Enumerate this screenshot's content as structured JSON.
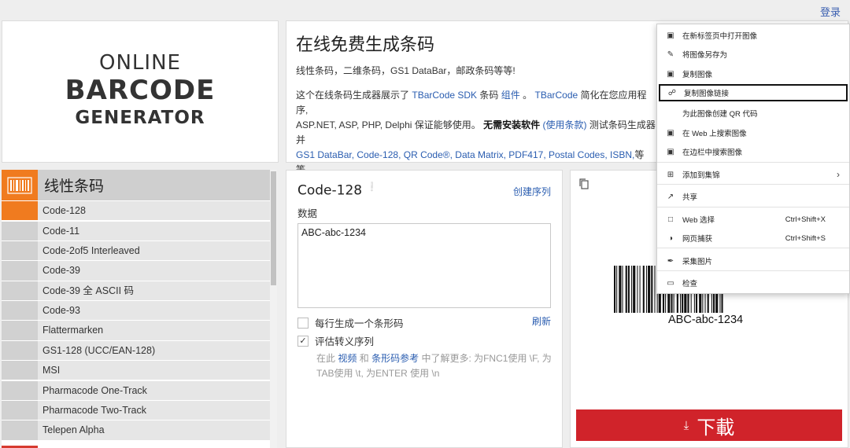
{
  "header": {
    "login": "登录"
  },
  "logo": {
    "line1": "ONLINE",
    "line2": "BARCODE",
    "line3": "GENERATOR"
  },
  "intro": {
    "title": "在线免费生成条码",
    "subtitle": "线性条码，二维条码，GS1 DataBar，邮政条码等等!",
    "desc_1": "这个在线条码生成器展示了",
    "desc_link_sdk": "TBarCode SDK",
    "desc_2": "条码",
    "desc_link_component": "组件",
    "desc_3": "。",
    "desc_link_tbarcode": "TBarCode",
    "desc_4": "简化在您应用程序,",
    "desc_5": "ASP.NET, ASP, PHP, Delphi 保证能够使用。",
    "desc_bold": "无需安装软件",
    "desc_link_terms": "(使用条款)",
    "desc_6": "测试条码生成器并",
    "desc_links_types": "GS1 DataBar, Code-128, QR Code®, Data Matrix, PDF417, Postal Codes, ISBN,",
    "desc_7": "等等。"
  },
  "sidebar": {
    "header": "线性条码",
    "items": [
      {
        "label": "Code-128",
        "active": true
      },
      {
        "label": "Code-11"
      },
      {
        "label": "Code-2of5 Interleaved"
      },
      {
        "label": "Code-39"
      },
      {
        "label": "Code-39 全 ASCII 码"
      },
      {
        "label": "Code-93"
      },
      {
        "label": "Flattermarken"
      },
      {
        "label": "GS1-128 (UCC/EAN-128)"
      },
      {
        "label": "MSI"
      },
      {
        "label": "Pharmacode One-Track"
      },
      {
        "label": "Pharmacode Two-Track"
      },
      {
        "label": "Telepen Alpha"
      }
    ]
  },
  "data_panel": {
    "title": "Code-128",
    "info_icon": "info-icon",
    "create_series": "创建序列",
    "data_label": "数据",
    "data_value": "ABC-abc-1234",
    "one_per_line": "每行生成一个条形码",
    "refresh": "刷新",
    "eval_escape": "评估转义序列",
    "hint_1": "在此",
    "hint_video": "视频",
    "hint_2": "和",
    "hint_ref": "条形码参考",
    "hint_3": "中了解更多: 为FNC1使用 \\F, 为TAB使用 \\t, 为ENTER 使用 \\n",
    "eval_checked": true,
    "one_per_line_checked": false
  },
  "preview": {
    "barcode_text": "ABC-abc-1234",
    "download": "下載",
    "download_icon": "download-icon",
    "copy_icon": "copy-icon"
  },
  "context_menu": {
    "items": [
      {
        "label": "在新标签页中打开图像",
        "icon": "new-tab-icon"
      },
      {
        "label": "将图像另存为",
        "icon": "save-icon"
      },
      {
        "label": "复制图像",
        "icon": "image-icon"
      },
      {
        "label": "复制图像链接",
        "icon": "link-icon",
        "highlighted": true
      },
      {
        "label": "为此图像创建 QR 代码",
        "icon": "none"
      },
      {
        "label": "在 Web 上搜索图像",
        "icon": "search-icon"
      },
      {
        "label": "在边栏中搜索图像",
        "icon": "sidebar-search-icon"
      },
      {
        "label": "添加到集锦",
        "icon": "collections-icon",
        "submenu": true
      },
      {
        "label": "共享",
        "icon": "share-icon"
      },
      {
        "label": "Web 选择",
        "icon": "web-select-icon",
        "shortcut": "Ctrl+Shift+X"
      },
      {
        "label": "网页捕获",
        "icon": "capture-icon",
        "shortcut": "Ctrl+Shift+S"
      },
      {
        "label": "采集图片",
        "icon": "collect-icon"
      },
      {
        "label": "检查",
        "icon": "inspect-icon"
      }
    ]
  },
  "colors": {
    "accent_orange": "#f07b1f",
    "download_red": "#d0232a",
    "link_blue": "#2a5db0"
  }
}
